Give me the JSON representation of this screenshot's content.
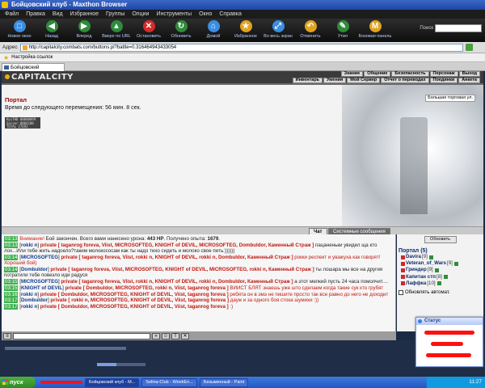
{
  "window": {
    "title": "Бойцовский клуб - Maxthon Browser"
  },
  "menu": [
    "Файл",
    "Правка",
    "Вид",
    "Избранное",
    "Группы",
    "Опции",
    "Инструменты",
    "Окно",
    "Справка"
  ],
  "toolbar": [
    {
      "label": "Новое окно",
      "icon": "new-window-icon",
      "color": "#3b8de0",
      "glyph": "□"
    },
    {
      "label": "Назад",
      "icon": "back-icon",
      "color": "#2e8b3a",
      "glyph": "◀"
    },
    {
      "label": "Вперед",
      "icon": "forward-icon",
      "color": "#2e8b3a",
      "glyph": "▶"
    },
    {
      "label": "Вверх по URL",
      "icon": "up-icon",
      "color": "#2e8b3a",
      "glyph": "▲"
    },
    {
      "label": "Остановить",
      "icon": "stop-icon",
      "color": "#d62b2b",
      "glyph": "✕"
    },
    {
      "label": "Обновить",
      "icon": "refresh-icon",
      "color": "#2e8b3a",
      "glyph": "↻"
    },
    {
      "label": "Домой",
      "icon": "home-icon",
      "color": "#3b8de0",
      "glyph": "⌂"
    },
    {
      "label": "Избранное",
      "icon": "favorites-icon",
      "color": "#e0a320",
      "glyph": "★"
    },
    {
      "label": "Во весь экран",
      "icon": "fullscreen-icon",
      "color": "#3b8de0",
      "glyph": "⤢"
    },
    {
      "label": "Отменить",
      "icon": "undo-icon",
      "color": "#e0a320",
      "glyph": "↶"
    },
    {
      "label": "Утил",
      "icon": "utilities-icon",
      "color": "#2e8b3a",
      "glyph": "✎"
    },
    {
      "label": "Боковая панель",
      "icon": "sidebar-icon",
      "color": "#e0a320",
      "glyph": "M"
    }
  ],
  "search": {
    "label": "Поиск"
  },
  "address": {
    "label": "Адрес",
    "url": "http://capitalcity.combats.com/buttons.pl?battle=0.316464943433054"
  },
  "bookmarks": {
    "label": "Настройка ссылок"
  },
  "tab": {
    "label": "Бойцовский"
  },
  "game": {
    "logo": "CAPITALCITY",
    "nav_top": [
      "Знание",
      "Общение",
      "Безопасность",
      "Персонаж",
      "Выход"
    ],
    "nav_bottom": [
      "Инвентарь",
      "Умения",
      "Мой Сервер",
      "Отчет о переводах",
      "Поединки",
      "Анкета"
    ]
  },
  "portal": {
    "title": "Портал",
    "move_time": "Время до следующего перемещения: 56 мин. 8 сек.",
    "trade_button": "Большая торговая ул.",
    "counter_lines": [
      "HyiTHD 00000099",
      "Server 0004100",
      "TOTAL  27692"
    ]
  },
  "chat_tabs": {
    "chat": "Чат",
    "system": "Системные сообщения"
  },
  "chat": [
    {
      "time": "03:13",
      "type": "system",
      "warn": "Внимание!",
      "text": "Бой закончен. Всего вами нанесено урона: ",
      "dmg": "443 HP",
      "text2": ". Получено опыта: ",
      "xp": "1679",
      "text3": "."
    },
    {
      "time": "03:13",
      "sender": "rokki n",
      "recipients": "private [ taganrog foreva, Viist, MICROSOFTEG, KNIGHT of DEVIL, MICROSOFTEG, Dombuldor, Каменный Страж ]",
      "body": "пацаненьки увидел ща кто лох...Или тебе жить надоело?таким молокососам как ты надо тихо сидеть и молоко свое пить:))))))",
      "body_red": false
    },
    {
      "time": "03:14",
      "sender": "MICROSOFTEG",
      "recipients": "private [ taganrog foreva, Viist, rokki n, KNIGHT of DEVIL, rokki n, Dombuldor, Каменный Страж ]",
      "body": "рокки респект и уважуха как говорят! Хороший бой)",
      "body_red": true
    },
    {
      "time": "03:14",
      "sender": "Dombuldor",
      "recipients": "private [ taganrog foreva, Viist, MICROSOFTEG, KNIGHT of DEVIL, MICROSOFTEG, rokki n, Каменный Страж ]",
      "body": "ты лошара мы все на другия потратили тебе повезло иди радуся",
      "body_red": false
    },
    {
      "time": "03:15",
      "sender": "MICROSOFTEG",
      "recipients": "private [ taganrog foreva, Viist, rokki n, KNIGHT of DEVIL, rokki n, Dombuldor, Каменный Страж ]",
      "body": "а этот мелкий пусть 24 часа помолчит....",
      "body_red": false
    },
    {
      "time": "03:15",
      "sender": "KNIGHT of DEVIL",
      "recipients": "private [ Dombuldor, MICROSOFTEG, rokki n, Viist, taganrog foreva ]",
      "body": "ВИИСТ БЛЯТ знаешь уже што сделаем когда такие сук кто грубят",
      "body_red": true
    },
    {
      "time": "03:16",
      "sender": "rokki n",
      "recipients": "private [ Dombuldor, MICROSOFTEG, KNIGHT of DEVIL, Viist, taganrog foreva ]",
      "body": "ребята он в эмэ не пишите просто так все равно до него не доходит",
      "body_red": true
    },
    {
      "time": "03:17",
      "sender": "Dombuldor",
      "recipients": "private [ rokki n, MICROSOFTEG, KNIGHT of DEVIL, Viist, taganrog foreva ]",
      "body": "дауж и за одного боя стока шумихи :))",
      "body_red": true
    },
    {
      "time": "03:17",
      "sender": "rokki n",
      "recipients": "private [ Dombuldor, MICROSOFTEG, KNIGHT of DEVIL, Viist, taganrog foreva ]",
      "body": ":)",
      "body_red": true
    }
  ],
  "panel": {
    "refresh": "Обновить",
    "portal_label": "Портал (5)",
    "users": [
      {
        "name": "Davira",
        "level": "[9]"
      },
      {
        "name": "Veteran_of_Wars",
        "level": "[9]"
      },
      {
        "name": "Гриндер",
        "level": "[9]"
      },
      {
        "name": "Капитан стп",
        "level": "[8]"
      },
      {
        "name": "Лаффка",
        "level": "[10]"
      }
    ],
    "auto_update": "Обновлять автомат."
  },
  "status_popup": {
    "title": "Статус"
  },
  "taskbar": {
    "start": "пуск",
    "tasks": [
      "Бойцовский клуб - M...",
      "Selina-Club - WeekEn...",
      "Безымянный - Paint"
    ],
    "clock": "11:27"
  },
  "colors": {
    "accent": "#990000",
    "chat_time": "#3fb24e",
    "sender": "#0e3b8c",
    "private": "#c2170e"
  }
}
